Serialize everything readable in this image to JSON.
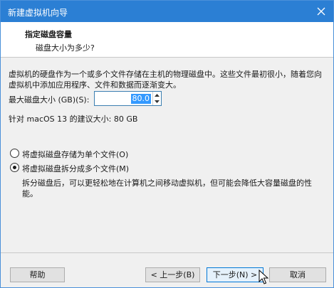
{
  "window": {
    "title": "新建虚拟机向导"
  },
  "header": {
    "title": "指定磁盘容量",
    "subtitle": "磁盘大小为多少?"
  },
  "content": {
    "description": "虚拟机的硬盘作为一个或多个文件存储在主机的物理磁盘中。这些文件最初很小，随着您向虚拟机中添加应用程序、文件和数据而逐渐变大。",
    "max_disk_label": "最大磁盘大小 (GB)(S):",
    "max_disk_value": "80.0",
    "recommended": "针对 macOS 13 的建议大小: 80 GB",
    "options": [
      {
        "label": "将虚拟磁盘存储为单个文件(O)",
        "checked": false
      },
      {
        "label": "将虚拟磁盘拆分成多个文件(M)",
        "checked": true
      }
    ],
    "split_hint": "拆分磁盘后，可以更轻松地在计算机之间移动虚拟机，但可能会降低大容量磁盘的性能。"
  },
  "buttons": {
    "help": "帮助",
    "back": "< 上一步(B)",
    "next": "下一步(N) >",
    "cancel": "取消"
  },
  "icons": [
    "close-icon",
    "spin-up-icon",
    "spin-down-icon",
    "mouse-cursor-icon"
  ],
  "colors": {
    "titlebar": "#2b7fd4",
    "selection": "#3399ff",
    "focus_border": "#0078d7"
  }
}
